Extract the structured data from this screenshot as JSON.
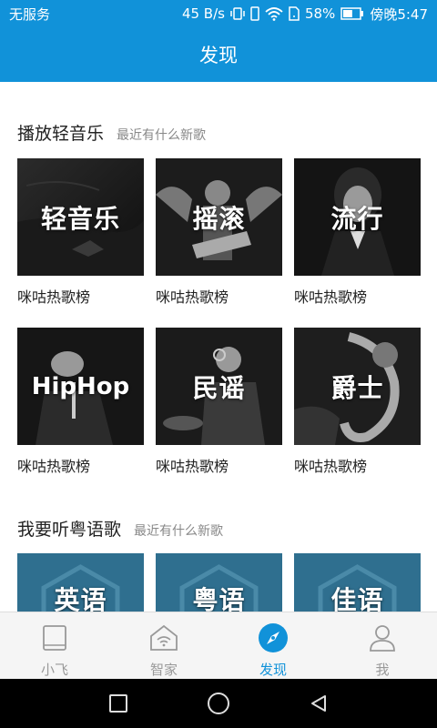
{
  "status_bar": {
    "carrier": "无服务",
    "speed": "45 B/s",
    "battery_percent": "58%",
    "time": "傍晚5:47",
    "battery_level": 0.58
  },
  "app_bar": {
    "title": "发现"
  },
  "sections": [
    {
      "title": "播放轻音乐",
      "subtitle": "最近有什么新歌",
      "cards": [
        {
          "label": "轻音乐",
          "caption": "咪咕热歌榜"
        },
        {
          "label": "摇滚",
          "caption": "咪咕热歌榜"
        },
        {
          "label": "流行",
          "caption": "咪咕热歌榜"
        },
        {
          "label": "HipHop",
          "caption": "咪咕热歌榜"
        },
        {
          "label": "民谣",
          "caption": "咪咕热歌榜"
        },
        {
          "label": "爵士",
          "caption": "咪咕热歌榜"
        }
      ]
    },
    {
      "title": "我要听粤语歌",
      "subtitle": "最近有什么新歌",
      "cards": [
        {
          "label": "英语"
        },
        {
          "label": "粤语"
        },
        {
          "label": "佳语"
        }
      ]
    }
  ],
  "bottom_nav": [
    {
      "label": "小飞",
      "icon": "tablet-icon",
      "active": false
    },
    {
      "label": "智家",
      "icon": "smart-home-icon",
      "active": false
    },
    {
      "label": "发现",
      "icon": "compass-icon",
      "active": true
    },
    {
      "label": "我",
      "icon": "person-icon",
      "active": false
    }
  ],
  "system_nav": [
    "recents-square-icon",
    "home-circle-icon",
    "back-triangle-icon"
  ],
  "colors": {
    "accent": "#1192d9",
    "nav_inactive": "#999999",
    "teal_cover": "#2f6f8f"
  }
}
